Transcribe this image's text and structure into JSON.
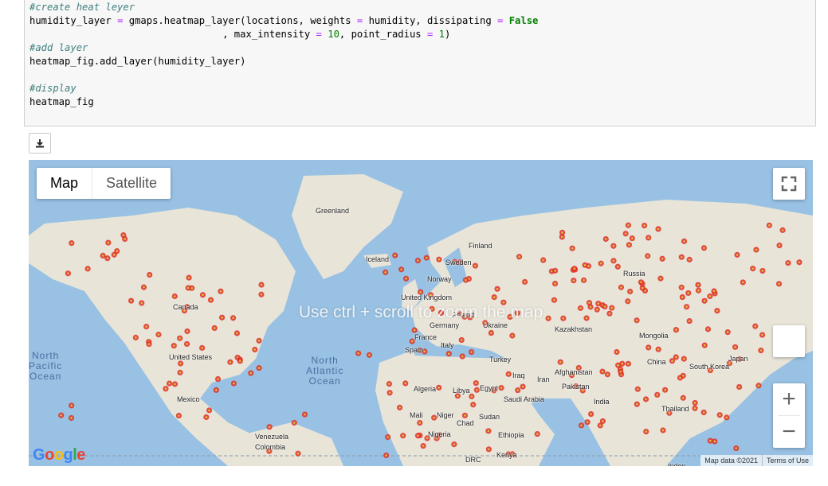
{
  "code_cell": {
    "lines": [
      {
        "comment": "#create heat leyer"
      },
      {
        "parts": [
          [
            "humidity_layer ",
            ""
          ],
          [
            "=",
            "o"
          ],
          [
            " gmaps.heatmap_layer(locations, weights ",
            ""
          ],
          [
            "=",
            "o"
          ],
          [
            " humidity, dissipating ",
            ""
          ],
          [
            "=",
            "o"
          ],
          [
            " ",
            ""
          ],
          [
            "False",
            "k"
          ]
        ]
      },
      {
        "parts": [
          [
            "                                 , max_intensity ",
            ""
          ],
          [
            "=",
            "o"
          ],
          [
            " ",
            ""
          ],
          [
            "10",
            "n"
          ],
          [
            ", point_radius ",
            ""
          ],
          [
            "=",
            "o"
          ],
          [
            " ",
            ""
          ],
          [
            "1",
            "n"
          ],
          [
            ")",
            ""
          ]
        ]
      },
      {
        "comment": "#add layer"
      },
      {
        "parts": [
          [
            "heatmap_fig.add_layer(humidity_layer)",
            ""
          ]
        ]
      },
      {
        "parts": []
      },
      {
        "comment": "#display"
      },
      {
        "parts": [
          [
            "heatmap_fig",
            ""
          ]
        ]
      }
    ]
  },
  "download_icon": "download-icon",
  "map": {
    "map_type": {
      "map": "Map",
      "satellite": "Satellite"
    },
    "scroll_message": "Use ctrl + scroll to zoom the map",
    "google_logo": "Google",
    "attribution": "Map data ©2021",
    "terms": "Terms of Use",
    "zoom_in": "+",
    "zoom_out": "−",
    "colors": {
      "water": "#98c1e3",
      "land": "#e8e4d8",
      "point_outer": "#e0302a",
      "point_inner": "#d8c23a"
    },
    "ocean_labels": [
      "North\nPacific\nOcean",
      "North\nAtlantic\nOcean"
    ],
    "labels": [
      "Greenland",
      "Iceland",
      "Finland",
      "Sweden",
      "Norway",
      "Russia",
      "Canada",
      "United Kingdom",
      "Poland",
      "Germany",
      "Ukraine",
      "France",
      "Kazakhstan",
      "Mongolia",
      "Spain",
      "Italy",
      "United States",
      "Turkey",
      "China",
      "South Korea",
      "Japan",
      "Iraq",
      "Afghanistan",
      "Iran",
      "Pakistan",
      "Algeria",
      "Libya",
      "Egypt",
      "Saudi Arabia",
      "India",
      "Mexico",
      "Mali",
      "Niger",
      "Sudan",
      "Chad",
      "Thailand",
      "Nigeria",
      "Ethiopia",
      "Venezuela",
      "Colombia",
      "DRC",
      "Kenya",
      "Indon"
    ]
  }
}
